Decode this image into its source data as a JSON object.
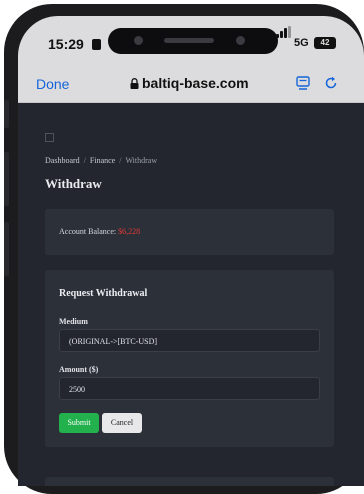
{
  "status_bar": {
    "time": "15:29",
    "network": "5G",
    "battery": "42"
  },
  "browser": {
    "done_label": "Done",
    "url": "baltiq-base.com"
  },
  "breadcrumb": {
    "items": [
      "Dashboard",
      "Finance",
      "Withdraw"
    ],
    "separator": "/"
  },
  "page": {
    "title": "Withdraw"
  },
  "balance": {
    "label": "Account Balance:",
    "value": "$6,228"
  },
  "form": {
    "title": "Request Withdrawal",
    "medium_label": "Medium",
    "medium_value": "(ORIGINAL->[BTC-USD]",
    "amount_label": "Amount ($)",
    "amount_value": "2500",
    "submit_label": "Submit",
    "cancel_label": "Cancel"
  },
  "colors": {
    "submit": "#22b14c",
    "balance_value": "#e53935",
    "link": "#1565d8"
  },
  "icons": [
    "lock-icon",
    "reader-mode-icon",
    "reload-icon",
    "menu-icon"
  ]
}
